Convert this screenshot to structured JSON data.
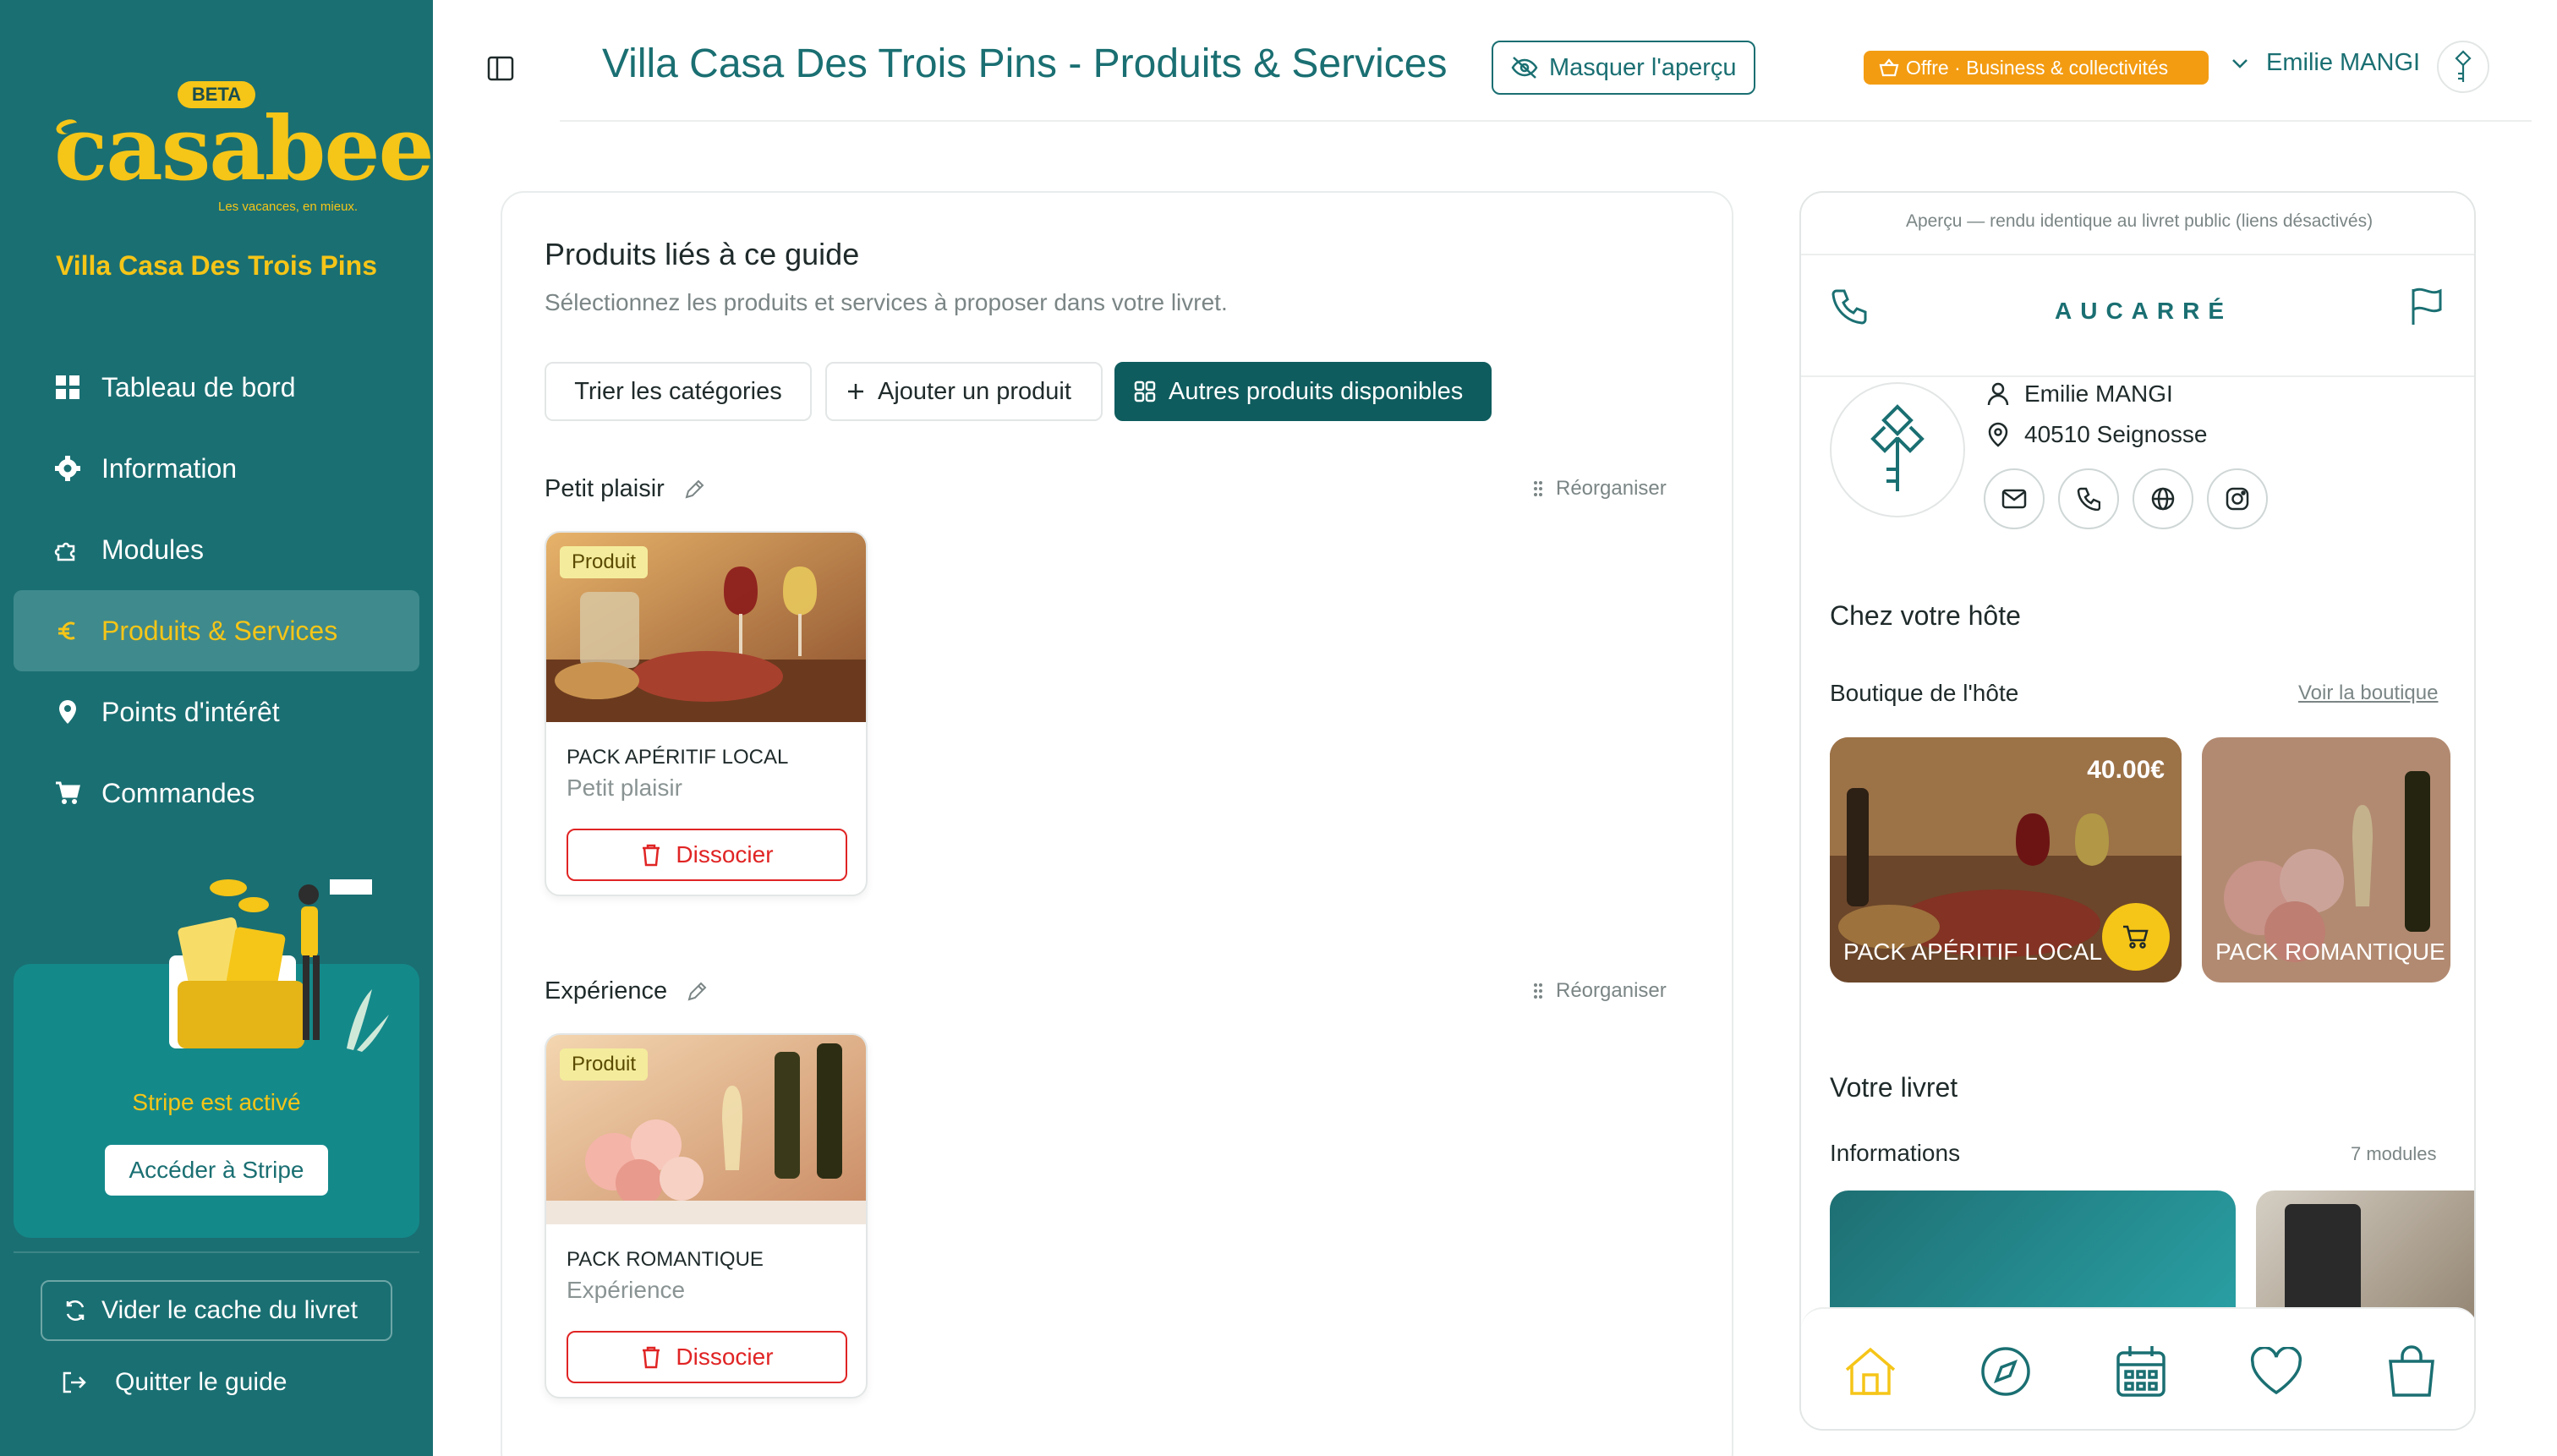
{
  "sidebar": {
    "beta_label": "BETA",
    "logo_text": "casabee",
    "tagline": "Les vacances, en mieux.",
    "villa_name": "Villa Casa Des Trois Pins",
    "nav": [
      {
        "label": "Tableau de bord",
        "icon": "dashboard-icon"
      },
      {
        "label": "Information",
        "icon": "gear-icon"
      },
      {
        "label": "Modules",
        "icon": "puzzle-icon"
      },
      {
        "label": "Produits & Services",
        "icon": "euro-icon",
        "active": true
      },
      {
        "label": "Points d'intérêt",
        "icon": "map-pin-icon"
      },
      {
        "label": "Commandes",
        "icon": "cart-icon"
      }
    ],
    "stripe_status": "Stripe est activé",
    "stripe_button": "Accéder à Stripe",
    "cache_button": "Vider le cache du livret",
    "quit_label": "Quitter le guide"
  },
  "header": {
    "title": "Villa Casa Des Trois Pins - Produits & Services",
    "hide_preview": "Masquer l'aperçu",
    "offer_badge": "Offre · Business & collectivités",
    "user_name": "Emilie MANGI"
  },
  "products": {
    "title": "Produits liés à ce guide",
    "subtitle": "Sélectionnez les produits et services à proposer dans votre livret.",
    "sort_button": "Trier les catégories",
    "add_button": "Ajouter un produit",
    "other_button": "Autres produits disponibles",
    "reorganize_label": "Réorganiser",
    "categories": [
      {
        "name": "Petit plaisir",
        "items": [
          {
            "tag": "Produit",
            "name": "PACK APÉRITIF LOCAL",
            "category": "Petit plaisir",
            "action": "Dissocier"
          }
        ]
      },
      {
        "name": "Expérience",
        "items": [
          {
            "tag": "Produit",
            "name": "PACK ROMANTIQUE",
            "category": "Expérience",
            "action": "Dissocier"
          }
        ]
      }
    ]
  },
  "preview": {
    "note": "Aperçu — rendu identique au livret public (liens désactivés)",
    "brand": "AUCARRÉ",
    "host_name": "Emilie MANGI",
    "host_location": "40510 Seignosse",
    "section_host": "Chez votre hôte",
    "shop_title": "Boutique de l'hôte",
    "shop_link": "Voir la boutique",
    "shop_items": [
      {
        "name": "PACK APÉRITIF LOCAL",
        "price": "40.00€"
      },
      {
        "name": "PACK ROMANTIQUE",
        "price": ""
      }
    ],
    "section_livret": "Votre livret",
    "info_title": "Informations",
    "info_count": "7 modules"
  },
  "colors": {
    "sidebar_bg": "#1a6f72",
    "accent_yellow": "#f5c518",
    "primary_dark": "#0f5c5e",
    "danger": "#e02424",
    "offer_orange": "#f39c12"
  }
}
